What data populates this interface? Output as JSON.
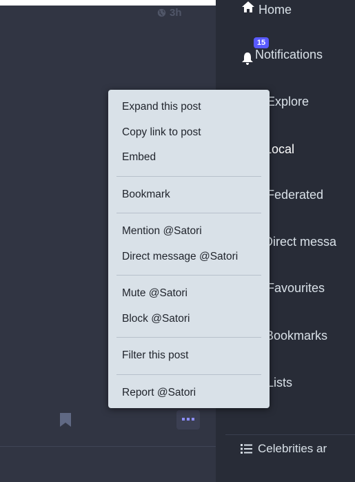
{
  "post": {
    "timestamp": "3h",
    "visibility_icon": "globe-icon",
    "actions": {
      "bookmark_icon": "bookmark-icon",
      "more_icon": "ellipsis-icon"
    }
  },
  "dropdown": {
    "groups": [
      [
        "Expand this post",
        "Copy link to post",
        "Embed"
      ],
      [
        "Bookmark"
      ],
      [
        "Mention @Satori",
        "Direct message @Satori"
      ],
      [
        "Mute @Satori",
        "Block @Satori"
      ],
      [
        "Filter this post"
      ],
      [
        "Report @Satori"
      ]
    ]
  },
  "nav": {
    "items": [
      {
        "label": "Home",
        "icon": "home-icon"
      },
      {
        "label": "Notifications",
        "icon": "bell-icon",
        "badge": "15"
      },
      {
        "label": "Explore",
        "icon": "hashtag-icon"
      },
      {
        "label": "Local",
        "icon": "users-icon"
      },
      {
        "label": "Federated",
        "icon": "globe-icon"
      },
      {
        "label": "Direct messa",
        "icon": "at-icon"
      },
      {
        "label": "Favourites",
        "icon": "star-icon"
      },
      {
        "label": "Bookmarks",
        "icon": "bookmark-icon"
      },
      {
        "label": "Lists",
        "icon": "list-icon"
      }
    ],
    "lists": [
      {
        "label": "Celebrities ar",
        "icon": "list-ul-icon"
      }
    ]
  },
  "colors": {
    "accent": "#595aff",
    "menu_bg": "#d9e1e8",
    "left_bg": "#313543",
    "right_bg": "#282c37"
  }
}
